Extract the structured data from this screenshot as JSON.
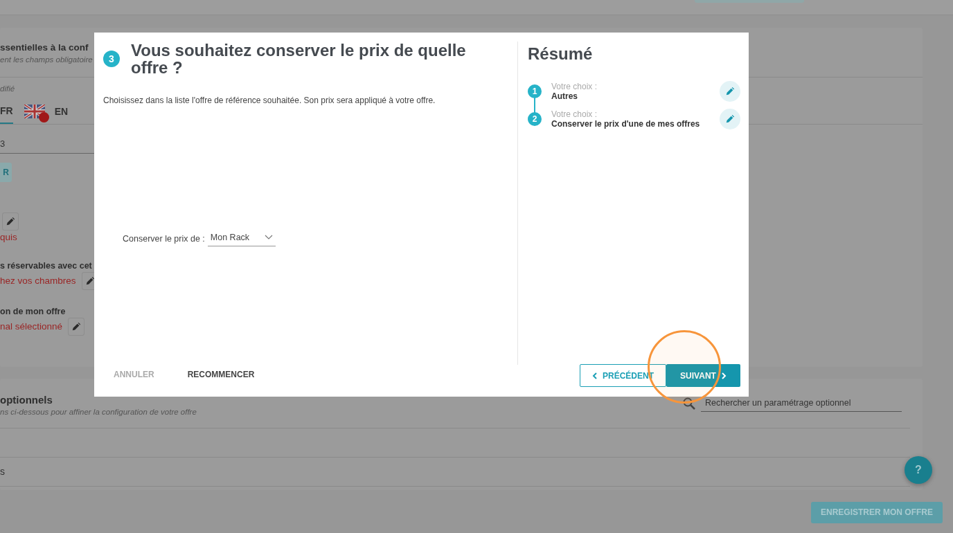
{
  "background": {
    "essentials": {
      "title": "ssentielles à la conf",
      "subtitle": "ent les champs obligatoire",
      "modified": "difié",
      "tabs": [
        {
          "label": "FR",
          "selected": true,
          "kind": "text",
          "error": false
        },
        {
          "label": "EN",
          "selected": false,
          "kind": "flag",
          "error": true
        }
      ],
      "field_value": "3",
      "button": "R",
      "rows": [
        {
          "title": "",
          "value": "quis"
        },
        {
          "title": "s réservables avec cet",
          "value": "hez vos chambres"
        },
        {
          "title": "on de mon offre",
          "value": "nal sélectionné"
        }
      ]
    },
    "optional": {
      "title": "optionnels",
      "subtitle": "ns ci-dessous pour affiner la configuration de votre offre",
      "search": {
        "placeholder": "Rechercher un paramétrage optionnel"
      },
      "rows": [
        "",
        "s",
        ""
      ]
    },
    "save_button": "ENREGISTRER MON OFFRE",
    "help_button": "?"
  },
  "modal": {
    "step": "3",
    "title": "Vous souhaitez conserver le prix de quelle offre ?",
    "description": "Choisissez dans la liste l'offre de référence souhaitée. Son prix sera appliqué à votre offre.",
    "select": {
      "label": "Conserver le prix de :",
      "value": "Mon Rack"
    },
    "summary": {
      "title": "Résumé",
      "steps": [
        {
          "number": "1",
          "label": "Votre choix :",
          "value": "Autres"
        },
        {
          "number": "2",
          "label": "Votre choix :",
          "value": "Conserver le prix d'une de mes offres"
        }
      ]
    },
    "footer": {
      "cancel": "ANNULER",
      "restart": "RECOMMENCER",
      "previous": "PRÉCÉDENT",
      "next": "SUIVANT"
    }
  }
}
